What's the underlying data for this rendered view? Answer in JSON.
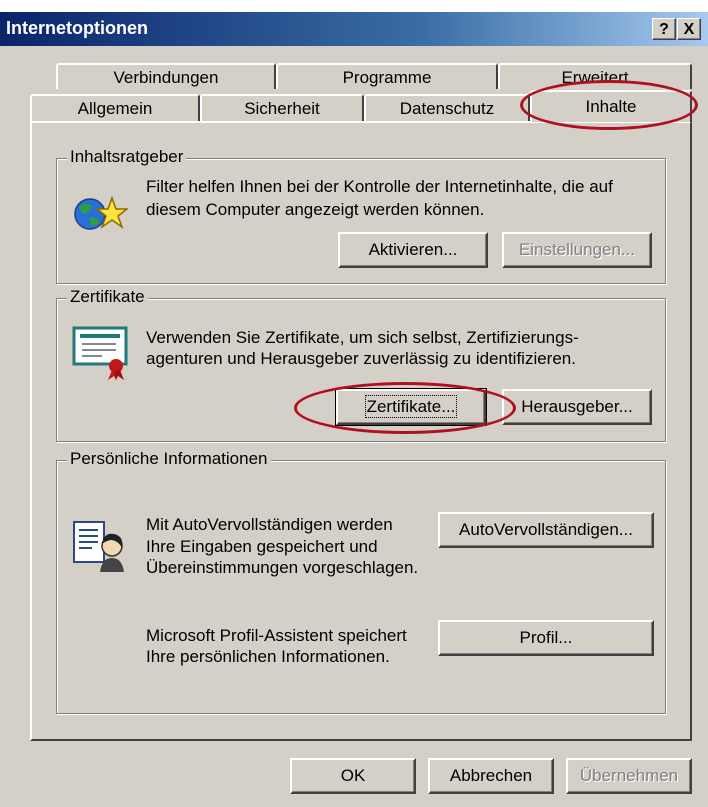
{
  "window": {
    "title": "Internetoptionen",
    "help_label": "?",
    "close_label": "X"
  },
  "tabs": {
    "row1": [
      "Verbindungen",
      "Programme",
      "Erweitert"
    ],
    "row2": [
      "Allgemein",
      "Sicherheit",
      "Datenschutz",
      "Inhalte"
    ],
    "selected": "Inhalte"
  },
  "content_advisor": {
    "title": "Inhaltsratgeber",
    "description_line1": "Filter helfen Ihnen bei der Kontrolle der Internetinhalte, die auf",
    "description_line2": "diesem Computer angezeigt werden können.",
    "enable_button": "Aktivieren...",
    "settings_button": "Einstellungen..."
  },
  "certificates": {
    "title": "Zertifikate",
    "description_line1": "Verwenden Sie Zertifikate, um sich selbst, Zertifizierungs-",
    "description_line2": "agenturen und Herausgeber zuverlässig zu identifizieren.",
    "certificates_button": "Zertifikate...",
    "publishers_button": "Herausgeber..."
  },
  "personal_info": {
    "title": "Persönliche Informationen",
    "autocomplete_line1": "Mit AutoVervollständigen werden",
    "autocomplete_line2": "Ihre Eingaben gespeichert und",
    "autocomplete_line3": "Übereinstimmungen vorgeschlagen.",
    "autocomplete_button": "AutoVervollständigen...",
    "profile_line1": "Microsoft Profil-Assistent speichert",
    "profile_line2": "Ihre persönlichen Informationen.",
    "profile_button": "Profil..."
  },
  "footer": {
    "ok": "OK",
    "cancel": "Abbrechen",
    "apply": "Übernehmen"
  },
  "colors": {
    "titlebar_start": "#0a246a",
    "titlebar_end": "#a6caf0",
    "dialog_face": "#d4d0c8",
    "annotation_red": "#b01020"
  }
}
